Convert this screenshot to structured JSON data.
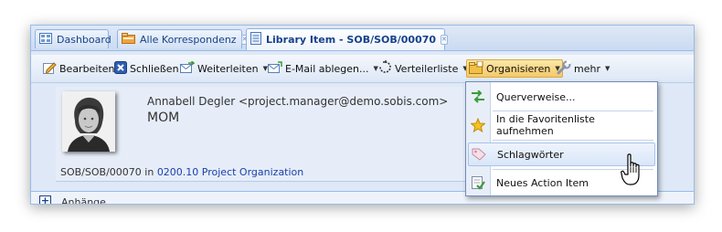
{
  "tabs": [
    {
      "label": "Dashboard",
      "icon": "dashboard-icon",
      "closable": false
    },
    {
      "label": "Alle Korrespondenz",
      "icon": "folder-icon",
      "closable": true
    },
    {
      "label": "Library Item - SOB/SOB/00070",
      "icon": "document-icon",
      "closable": true,
      "active": true
    }
  ],
  "toolbar": {
    "edit": "Bearbeiten",
    "close": "Schließen",
    "forward": "Weiterleiten",
    "email_file": "E-Mail ablegen...",
    "distribution": "Verteilerliste",
    "organize": "Organisieren",
    "more": "mehr"
  },
  "item": {
    "from": "Annabell Degler <project.manager@demo.sobis.com>",
    "subject": "MOM",
    "reference": "SOB/SOB/00070",
    "in_word": " in ",
    "folder_link": "0200.10 Project Organization"
  },
  "attachments": {
    "label": "Anhänge"
  },
  "organize_menu": [
    {
      "label": "Querverweise...",
      "icon": "crossref-icon"
    },
    {
      "label": "In die Favoritenliste aufnehmen",
      "icon": "star-icon"
    },
    {
      "label": "Schlagwörter",
      "icon": "tag-icon",
      "hover": true
    },
    {
      "label": "Neues Action Item",
      "icon": "action-item-icon"
    }
  ],
  "colors": {
    "accent": "#15428b",
    "link": "#1a3faa",
    "panel": "#dfe8f6",
    "pressed": "#f4c96a"
  }
}
